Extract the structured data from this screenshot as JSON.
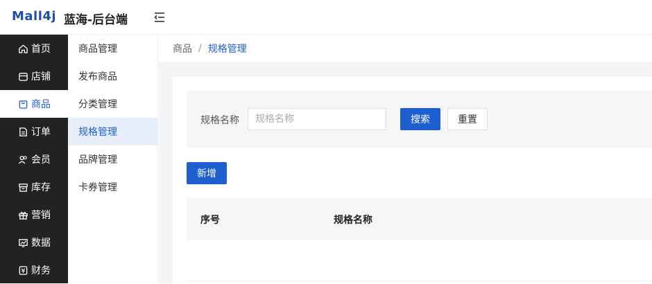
{
  "header": {
    "logo": "Mall4j",
    "brand": "蓝海-后台端"
  },
  "sidebar": {
    "items": [
      {
        "label": "首页",
        "icon": "home-icon"
      },
      {
        "label": "店铺",
        "icon": "shop-icon"
      },
      {
        "label": "商品",
        "icon": "bag-icon",
        "active": true
      },
      {
        "label": "订单",
        "icon": "order-icon"
      },
      {
        "label": "会员",
        "icon": "member-icon"
      },
      {
        "label": "库存",
        "icon": "stock-icon"
      },
      {
        "label": "营销",
        "icon": "gift-icon"
      },
      {
        "label": "数据",
        "icon": "chart-icon"
      },
      {
        "label": "财务",
        "icon": "finance-icon"
      }
    ]
  },
  "submenu": {
    "items": [
      {
        "label": "商品管理"
      },
      {
        "label": "发布商品"
      },
      {
        "label": "分类管理"
      },
      {
        "label": "规格管理",
        "active": true
      },
      {
        "label": "品牌管理"
      },
      {
        "label": "卡券管理"
      }
    ]
  },
  "breadcrumb": {
    "parent": "商品",
    "separator": "/",
    "current": "规格管理"
  },
  "search": {
    "label": "规格名称",
    "placeholder": "规格名称",
    "value": "",
    "search_button": "搜索",
    "reset_button": "重置"
  },
  "toolbar": {
    "add_button": "新增"
  },
  "table": {
    "columns": [
      "序号",
      "规格名称"
    ]
  },
  "colors": {
    "primary": "#1d5fd1",
    "sidebar_bg": "#222222",
    "submenu_active_bg": "#e8effb"
  }
}
